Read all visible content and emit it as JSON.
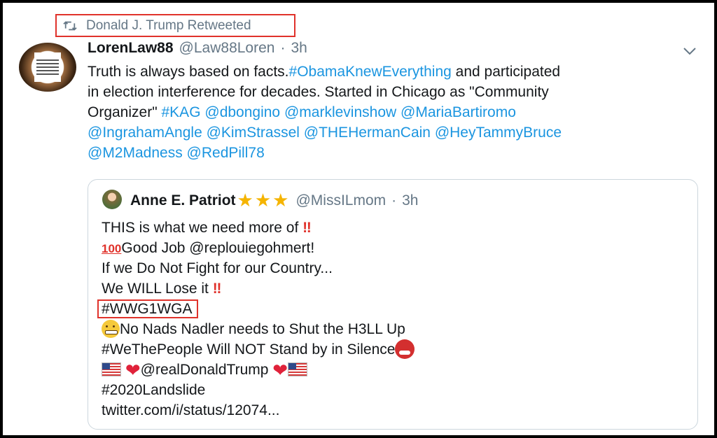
{
  "retweet": {
    "label": "Donald J. Trump Retweeted"
  },
  "tweet": {
    "display_name": "LorenLaw88",
    "handle": "@Law88Loren",
    "separator": "·",
    "time": "3h",
    "lines": [
      [
        {
          "t": "Truth is always based on facts."
        },
        {
          "t": "#ObamaKnewEverything",
          "link": true
        },
        {
          "t": " and participated"
        }
      ],
      [
        {
          "t": "in election interference for decades. Started in Chicago as \"Community"
        }
      ],
      [
        {
          "t": "Organizer\"  "
        },
        {
          "t": "#KAG",
          "link": true
        },
        {
          "t": " "
        },
        {
          "t": "@dbongino",
          "link": true
        },
        {
          "t": " "
        },
        {
          "t": "@marklevinshow",
          "link": true
        },
        {
          "t": " "
        },
        {
          "t": "@MariaBartiromo",
          "link": true
        }
      ],
      [
        {
          "t": " "
        },
        {
          "t": "@IngrahamAngle",
          "link": true
        },
        {
          "t": " "
        },
        {
          "t": "@KimStrassel",
          "link": true
        },
        {
          "t": " "
        },
        {
          "t": "@THEHermanCain",
          "link": true
        },
        {
          "t": " "
        },
        {
          "t": "@HeyTammyBruce",
          "link": true
        }
      ],
      [
        {
          "t": " "
        },
        {
          "t": "@M2Madness",
          "link": true
        },
        {
          "t": " "
        },
        {
          "t": "@RedPill78",
          "link": true
        }
      ]
    ]
  },
  "quote": {
    "display_name": "Anne E. Patriot",
    "stars": "★★★",
    "handle": "@MissILmom",
    "separator": "·",
    "time": "3h",
    "line1": "THIS is what we need more of ",
    "line1_emoji": "‼",
    "line2_emoji": "100",
    "line2": "Good Job @replouiegohmert!",
    "line3": "If we Do Not Fight for our Country...",
    "line4": "We WILL Lose it ",
    "line4_emoji": "‼",
    "line5": "#WWG1WGA",
    "line6": "No Nads Nadler needs to Shut the H3LL Up",
    "line7": "#WeThePeople Will NOT Stand by in Silence",
    "line8_mention": "@realDonaldTrump",
    "heart": "❤",
    "line9": "#2020Landslide",
    "line10": "twitter.com/i/status/12074..."
  },
  "colors": {
    "link": "#1b95e0",
    "highlight_box": "#e0322b",
    "muted": "#657786"
  }
}
